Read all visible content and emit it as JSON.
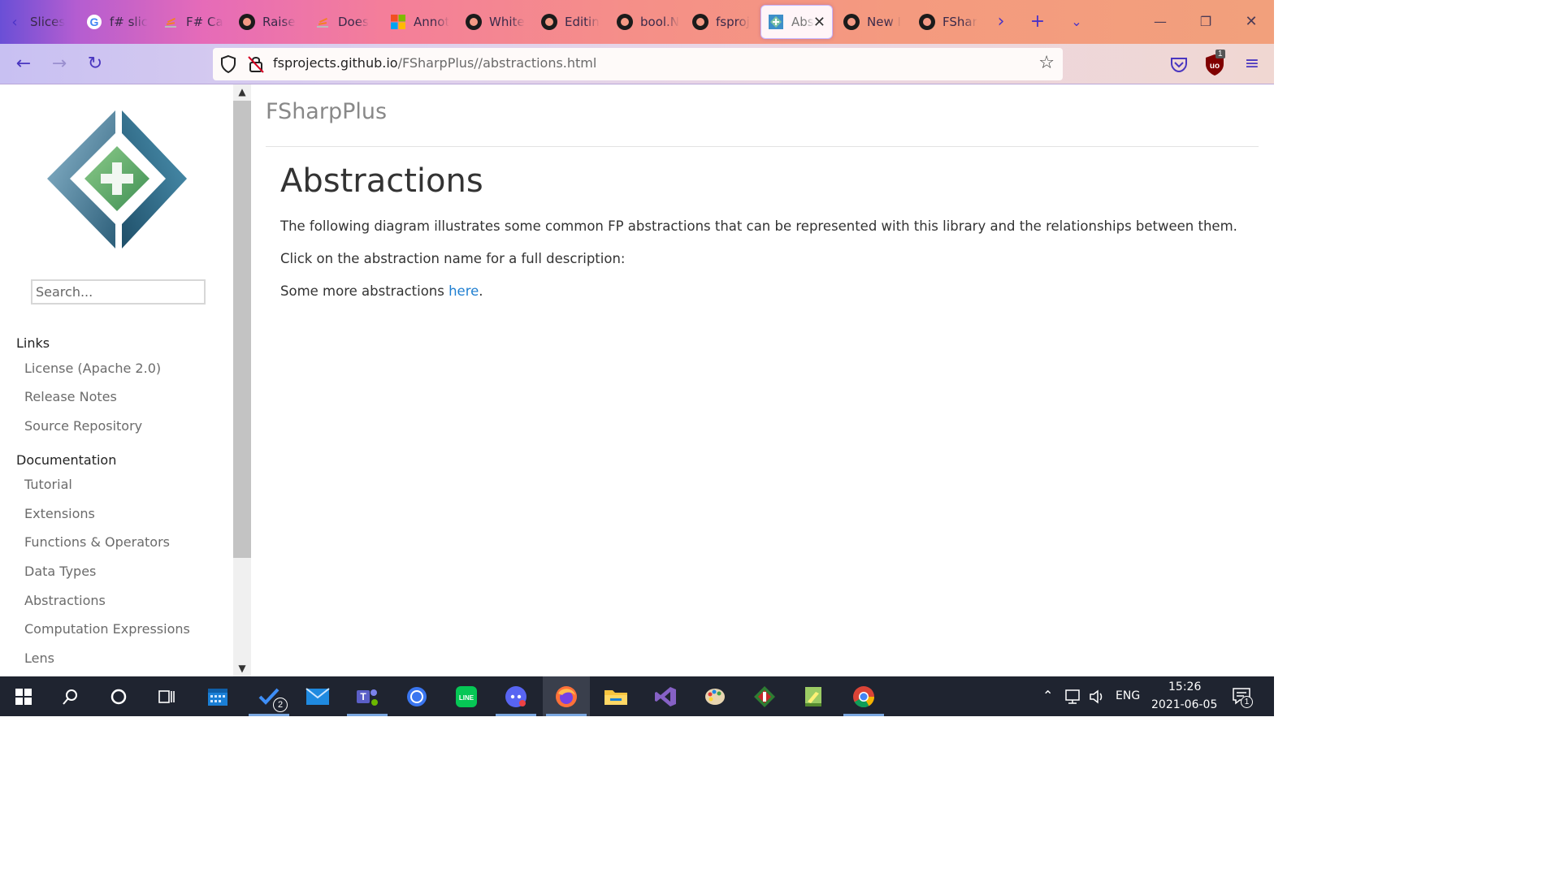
{
  "browser": {
    "tabs": [
      {
        "label": "Slices",
        "icon": "back-arrow-icon"
      },
      {
        "label": "f# slic",
        "icon": "google-icon"
      },
      {
        "label": "F# Ca",
        "icon": "stackoverflow-icon"
      },
      {
        "label": "Raise",
        "icon": "github-icon"
      },
      {
        "label": "Does",
        "icon": "stackoverflow-icon"
      },
      {
        "label": "Annot",
        "icon": "microsoft-icon"
      },
      {
        "label": "White",
        "icon": "github-icon"
      },
      {
        "label": "Editin",
        "icon": "github-icon"
      },
      {
        "label": "bool.N",
        "icon": "github-icon"
      },
      {
        "label": "fsproj",
        "icon": "github-icon"
      },
      {
        "label": "Abs",
        "icon": "fsharpplus-icon",
        "active": true
      },
      {
        "label": "New I",
        "icon": "github-icon"
      },
      {
        "label": "FSharp",
        "icon": "github-icon"
      }
    ],
    "url_host": "fsprojects.github.io",
    "url_path": "/FSharpPlus//abstractions.html",
    "ublock_badge": "1"
  },
  "sidebar": {
    "search_placeholder": "Search...",
    "links_heading": "Links",
    "links": [
      "License (Apache 2.0)",
      "Release Notes",
      "Source Repository"
    ],
    "docs_heading": "Documentation",
    "docs": [
      "Tutorial",
      "Extensions",
      "Functions & Operators",
      "Data Types",
      "Abstractions",
      "Computation Expressions",
      "Lens"
    ]
  },
  "content": {
    "brand": "FSharpPlus",
    "title": "Abstractions",
    "para1": "The following diagram illustrates some common FP abstractions that can be represented with this library and the relationships between them.",
    "para2": "Click on the abstraction name for a full description:",
    "para3_prefix": "Some more abstractions ",
    "para3_link": "here",
    "para3_suffix": "."
  },
  "taskbar": {
    "todo_badge": "2",
    "language": "ENG",
    "time": "15:26",
    "date": "2021-06-05",
    "notification_badge": "1"
  },
  "colors": {
    "link": "#1f7fd1",
    "tab_accent": "#4b33c7",
    "taskbar": "#1f2430"
  }
}
